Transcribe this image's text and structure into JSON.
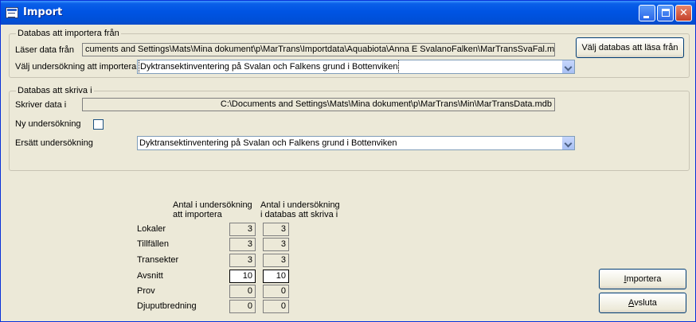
{
  "window": {
    "title": "Import"
  },
  "source_group": {
    "title": "Databas att importera från",
    "read_label": "Läser data från",
    "read_path": "cuments and Settings\\Mats\\Mina dokument\\p\\MarTrans\\Importdata\\Aquabiota\\Anna E SvalanoFalken\\MarTransSvaFal.mdb",
    "choose_db_button": "Välj databas att läsa från",
    "survey_label": "Välj undersökning att importera",
    "survey_value": "Dyktransektinventering på Svalan och Falkens grund i Bottenviken"
  },
  "target_group": {
    "title": "Databas att skriva i",
    "write_label": "Skriver data i",
    "write_path": "C:\\Documents and Settings\\Mats\\Mina dokument\\p\\MarTrans\\Min\\MarTransData.mdb",
    "new_survey_label": "Ny undersökning",
    "new_survey_checked": false,
    "replace_label": "Ersätt undersökning",
    "replace_value": "Dyktransektinventering på Svalan och Falkens grund i Bottenviken"
  },
  "counts": {
    "header_import_line1": "Antal i undersökning",
    "header_import_line2": "att importera",
    "header_target_line1": "Antal i undersökning",
    "header_target_line2": "i databas att skriva i",
    "rows": [
      {
        "label": "Lokaler",
        "import": "3",
        "target": "3"
      },
      {
        "label": "Tillfällen",
        "import": "3",
        "target": "3"
      },
      {
        "label": "Transekter",
        "import": "3",
        "target": "3"
      },
      {
        "label": "Avsnitt",
        "import": "10",
        "target": "10"
      },
      {
        "label": "Prov",
        "import": "0",
        "target": "0"
      },
      {
        "label": "Djuputbredning",
        "import": "0",
        "target": "0"
      }
    ]
  },
  "actions": {
    "import_prefix": "",
    "import_key": "I",
    "import_rest": "mportera",
    "close_prefix": "",
    "close_key": "A",
    "close_rest": "vsluta"
  }
}
